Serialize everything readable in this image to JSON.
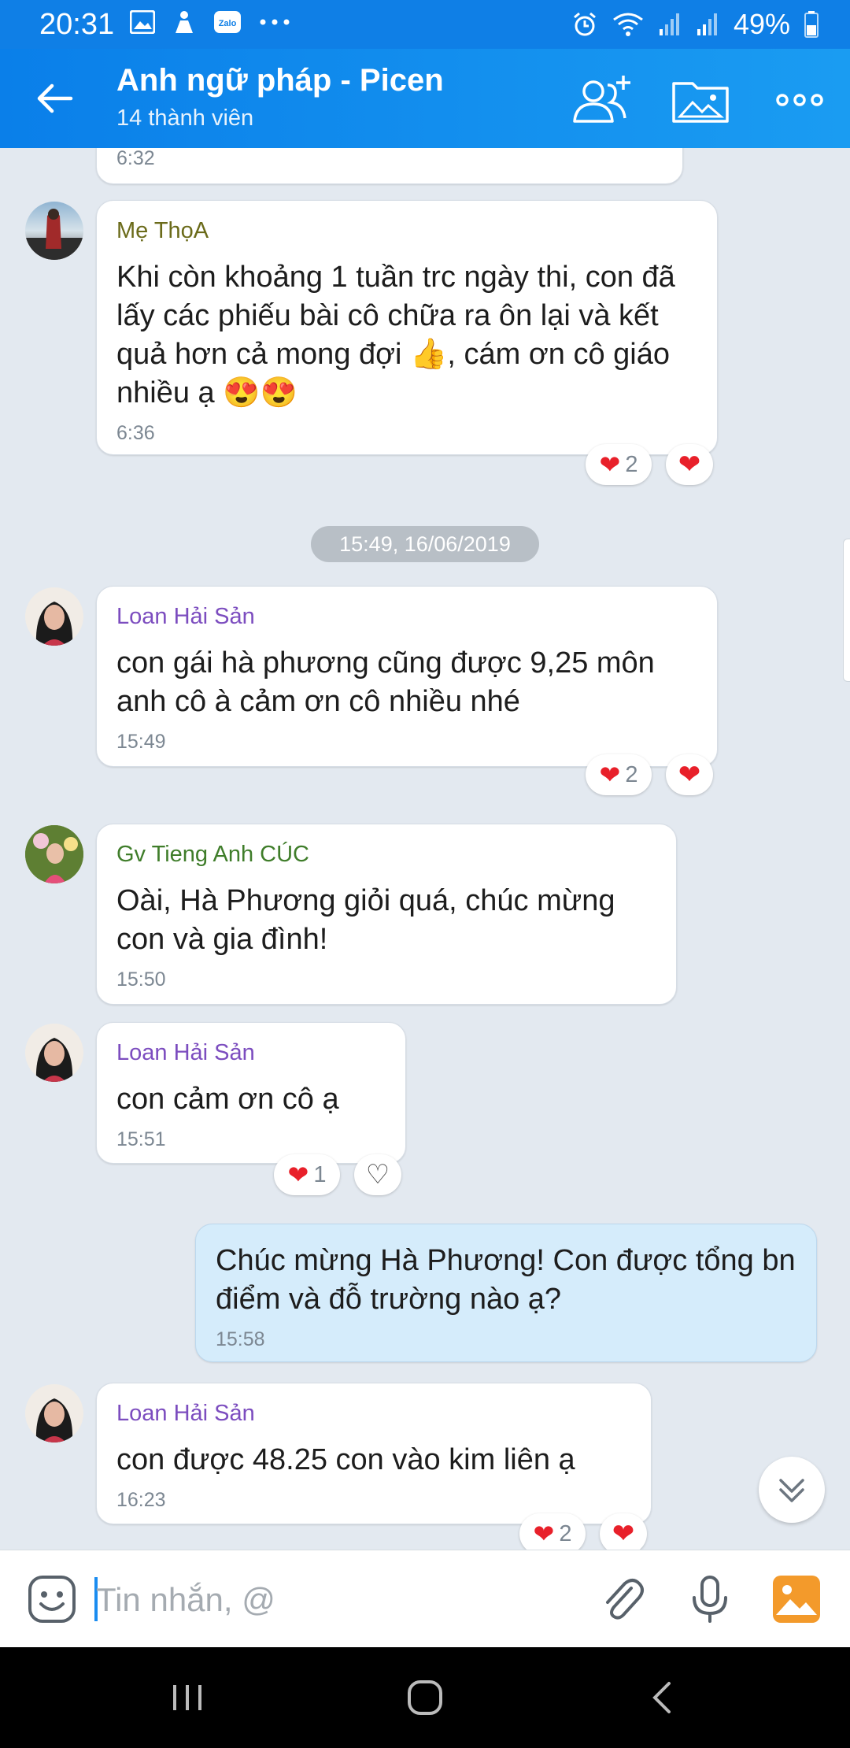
{
  "status_bar": {
    "time": "20:31",
    "battery": "49%",
    "icons": [
      "gallery-icon",
      "person-icon",
      "zalo-icon",
      "more-dots-icon",
      "alarm-icon",
      "wifi-icon",
      "signal-icon",
      "signal-icon",
      "battery-icon"
    ]
  },
  "header": {
    "title": "Anh ngữ pháp - Picen",
    "subtitle": "14 thành viên"
  },
  "messages": [
    {
      "time": "6:32"
    },
    {
      "sender": "Mẹ ThọA",
      "sender_color": "#6b6b1a",
      "text": "Khi còn khoảng 1 tuần trc ngày thi, con đã lấy các phiếu bài cô chữa ra ôn lại và kết quả hơn cả mong đợi 👍, cám ơn cô giáo nhiều ạ 😍😍",
      "time": "6:36",
      "reaction_count": "2"
    },
    {
      "sender": "Loan Hải Sản",
      "sender_color": "#7c4dbf",
      "text": "con gái hà phương cũng được 9,25 môn anh cô à  cảm ơn cô nhiều nhé",
      "time": "15:49",
      "reaction_count": "2"
    },
    {
      "sender": "Gv Tieng Anh CÚC",
      "sender_color": "#3f7d2a",
      "text": "Oài, Hà Phương giỏi quá, chúc mừng con và gia đình!",
      "time": "15:50"
    },
    {
      "sender": "Loan Hải Sản",
      "sender_color": "#7c4dbf",
      "text": "con cảm ơn cô ạ",
      "time": "15:51",
      "reaction_count": "1"
    },
    {
      "text": "Chúc mừng Hà Phương! Con được tổng bn điểm và đỗ trường nào ạ?",
      "time": "15:58"
    },
    {
      "sender": "Loan Hải Sản",
      "sender_color": "#7c4dbf",
      "text": "con được 48.25 con vào  kim liên ạ",
      "time": "16:23",
      "reaction_count": "2"
    }
  ],
  "date_separator": "15:49, 16/06/2019",
  "composer": {
    "placeholder": "Tin nhắn, @"
  },
  "colors": {
    "header": "#0a7fe9",
    "accent": "#1a8cf0",
    "heart": "#e8202a",
    "my_bubble": "#d5ecfb"
  }
}
